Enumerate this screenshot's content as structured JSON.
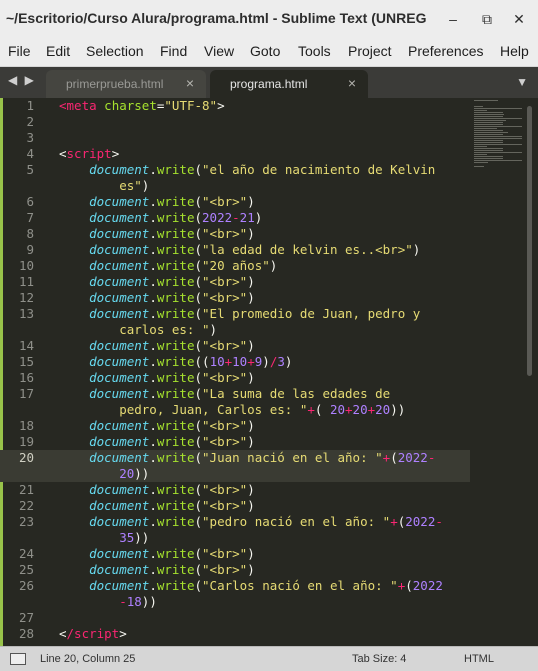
{
  "window": {
    "title": "~/Escritorio/Curso Alura/programa.html - Sublime Text (UNREGI..."
  },
  "controls": {
    "minimize": "–",
    "maximize": "⧉",
    "close": "✕"
  },
  "menu": [
    "File",
    "Edit",
    "Selection",
    "Find",
    "View",
    "Goto",
    "Tools",
    "Project",
    "Preferences",
    "Help"
  ],
  "nav": {
    "arrows": "◀ ▶"
  },
  "tabs": [
    {
      "label": "primerprueba.html",
      "close": "×"
    },
    {
      "label": "programa.html",
      "close": "×"
    }
  ],
  "tab_menu_glyph": "▼",
  "code": [
    {
      "n": "1",
      "t": [
        [
          "tag",
          "<"
        ],
        [
          "tag",
          "meta"
        ],
        [
          "attr",
          " charset"
        ],
        [
          "plain",
          "="
        ],
        [
          "str",
          "\"UTF-8\""
        ],
        [
          "plain",
          ">"
        ]
      ]
    },
    {
      "n": "2",
      "t": []
    },
    {
      "n": "3",
      "t": []
    },
    {
      "n": "4",
      "t": [
        [
          "plain",
          "<"
        ],
        [
          "tag",
          "script"
        ],
        [
          "plain",
          ">"
        ]
      ]
    },
    {
      "n": "5",
      "t": [
        [
          "plain",
          "    "
        ],
        [
          "obj",
          "document"
        ],
        [
          "plain",
          "."
        ],
        [
          "fn",
          "write"
        ],
        [
          "plain",
          "("
        ],
        [
          "str",
          "\"el año de nacimiento de Kelvin"
        ]
      ]
    },
    {
      "n": "",
      "t": [
        [
          "str",
          "        es\""
        ],
        [
          "plain",
          ")"
        ]
      ]
    },
    {
      "n": "6",
      "t": [
        [
          "plain",
          "    "
        ],
        [
          "obj",
          "document"
        ],
        [
          "plain",
          "."
        ],
        [
          "fn",
          "write"
        ],
        [
          "plain",
          "("
        ],
        [
          "str",
          "\"<br>\""
        ],
        [
          "plain",
          ")"
        ]
      ]
    },
    {
      "n": "7",
      "t": [
        [
          "plain",
          "    "
        ],
        [
          "obj",
          "document"
        ],
        [
          "plain",
          "."
        ],
        [
          "fn",
          "write"
        ],
        [
          "plain",
          "("
        ],
        [
          "num",
          "2022"
        ],
        [
          "op",
          "-"
        ],
        [
          "num",
          "21"
        ],
        [
          "plain",
          ")"
        ]
      ]
    },
    {
      "n": "8",
      "t": [
        [
          "plain",
          "    "
        ],
        [
          "obj",
          "document"
        ],
        [
          "plain",
          "."
        ],
        [
          "fn",
          "write"
        ],
        [
          "plain",
          "("
        ],
        [
          "str",
          "\"<br>\""
        ],
        [
          "plain",
          ")"
        ]
      ]
    },
    {
      "n": "9",
      "t": [
        [
          "plain",
          "    "
        ],
        [
          "obj",
          "document"
        ],
        [
          "plain",
          "."
        ],
        [
          "fn",
          "write"
        ],
        [
          "plain",
          "("
        ],
        [
          "str",
          "\"la edad de kelvin es..<br>\""
        ],
        [
          "plain",
          ")"
        ]
      ]
    },
    {
      "n": "10",
      "t": [
        [
          "plain",
          "    "
        ],
        [
          "obj",
          "document"
        ],
        [
          "plain",
          "."
        ],
        [
          "fn",
          "write"
        ],
        [
          "plain",
          "("
        ],
        [
          "str",
          "\"20 años\""
        ],
        [
          "plain",
          ")"
        ]
      ]
    },
    {
      "n": "11",
      "t": [
        [
          "plain",
          "    "
        ],
        [
          "obj",
          "document"
        ],
        [
          "plain",
          "."
        ],
        [
          "fn",
          "write"
        ],
        [
          "plain",
          "("
        ],
        [
          "str",
          "\"<br>\""
        ],
        [
          "plain",
          ")"
        ]
      ]
    },
    {
      "n": "12",
      "t": [
        [
          "plain",
          "    "
        ],
        [
          "obj",
          "document"
        ],
        [
          "plain",
          "."
        ],
        [
          "fn",
          "write"
        ],
        [
          "plain",
          "("
        ],
        [
          "str",
          "\"<br>\""
        ],
        [
          "plain",
          ")"
        ]
      ]
    },
    {
      "n": "13",
      "t": [
        [
          "plain",
          "    "
        ],
        [
          "obj",
          "document"
        ],
        [
          "plain",
          "."
        ],
        [
          "fn",
          "write"
        ],
        [
          "plain",
          "("
        ],
        [
          "str",
          "\"El promedio de Juan, pedro y"
        ]
      ]
    },
    {
      "n": "",
      "t": [
        [
          "str",
          "        carlos es: \""
        ],
        [
          "plain",
          ")"
        ]
      ]
    },
    {
      "n": "14",
      "t": [
        [
          "plain",
          "    "
        ],
        [
          "obj",
          "document"
        ],
        [
          "plain",
          "."
        ],
        [
          "fn",
          "write"
        ],
        [
          "plain",
          "("
        ],
        [
          "str",
          "\"<br>\""
        ],
        [
          "plain",
          ")"
        ]
      ]
    },
    {
      "n": "15",
      "t": [
        [
          "plain",
          "    "
        ],
        [
          "obj",
          "document"
        ],
        [
          "plain",
          "."
        ],
        [
          "fn",
          "write"
        ],
        [
          "plain",
          "(("
        ],
        [
          "num",
          "10"
        ],
        [
          "op",
          "+"
        ],
        [
          "num",
          "10"
        ],
        [
          "op",
          "+"
        ],
        [
          "num",
          "9"
        ],
        [
          "plain",
          ")"
        ],
        [
          "op",
          "/"
        ],
        [
          "num",
          "3"
        ],
        [
          "plain",
          ")"
        ]
      ]
    },
    {
      "n": "16",
      "t": [
        [
          "plain",
          "    "
        ],
        [
          "obj",
          "document"
        ],
        [
          "plain",
          "."
        ],
        [
          "fn",
          "write"
        ],
        [
          "plain",
          "("
        ],
        [
          "str",
          "\"<br>\""
        ],
        [
          "plain",
          ")"
        ]
      ]
    },
    {
      "n": "17",
      "t": [
        [
          "plain",
          "    "
        ],
        [
          "obj",
          "document"
        ],
        [
          "plain",
          "."
        ],
        [
          "fn",
          "write"
        ],
        [
          "plain",
          "("
        ],
        [
          "str",
          "\"La suma de las edades de"
        ]
      ]
    },
    {
      "n": "",
      "t": [
        [
          "str",
          "        pedro, Juan, Carlos es: \""
        ],
        [
          "op",
          "+"
        ],
        [
          "plain",
          "( "
        ],
        [
          "num",
          "20"
        ],
        [
          "op",
          "+"
        ],
        [
          "num",
          "20"
        ],
        [
          "op",
          "+"
        ],
        [
          "num",
          "20"
        ],
        [
          "plain",
          "))"
        ]
      ]
    },
    {
      "n": "18",
      "t": [
        [
          "plain",
          "    "
        ],
        [
          "obj",
          "document"
        ],
        [
          "plain",
          "."
        ],
        [
          "fn",
          "write"
        ],
        [
          "plain",
          "("
        ],
        [
          "str",
          "\"<br>\""
        ],
        [
          "plain",
          ")"
        ]
      ]
    },
    {
      "n": "19",
      "t": [
        [
          "plain",
          "    "
        ],
        [
          "obj",
          "document"
        ],
        [
          "plain",
          "."
        ],
        [
          "fn",
          "write"
        ],
        [
          "plain",
          "("
        ],
        [
          "str",
          "\"<br>\""
        ],
        [
          "plain",
          ")"
        ]
      ]
    },
    {
      "n": "20",
      "current": true,
      "t": [
        [
          "plain",
          "    "
        ],
        [
          "obj",
          "document"
        ],
        [
          "plain",
          "."
        ],
        [
          "fn",
          "write"
        ],
        [
          "plain",
          "("
        ],
        [
          "str",
          "\"Juan nació en el año: \""
        ],
        [
          "op",
          "+"
        ],
        [
          "plain",
          "("
        ],
        [
          "num",
          "2022"
        ],
        [
          "op",
          "-"
        ]
      ]
    },
    {
      "n": "",
      "current": true,
      "t": [
        [
          "num",
          "        20"
        ],
        [
          "plain",
          "))"
        ]
      ]
    },
    {
      "n": "21",
      "t": [
        [
          "plain",
          "    "
        ],
        [
          "obj",
          "document"
        ],
        [
          "plain",
          "."
        ],
        [
          "fn",
          "write"
        ],
        [
          "plain",
          "("
        ],
        [
          "str",
          "\"<br>\""
        ],
        [
          "plain",
          ")"
        ]
      ]
    },
    {
      "n": "22",
      "t": [
        [
          "plain",
          "    "
        ],
        [
          "obj",
          "document"
        ],
        [
          "plain",
          "."
        ],
        [
          "fn",
          "write"
        ],
        [
          "plain",
          "("
        ],
        [
          "str",
          "\"<br>\""
        ],
        [
          "plain",
          ")"
        ]
      ]
    },
    {
      "n": "23",
      "t": [
        [
          "plain",
          "    "
        ],
        [
          "obj",
          "document"
        ],
        [
          "plain",
          "."
        ],
        [
          "fn",
          "write"
        ],
        [
          "plain",
          "("
        ],
        [
          "str",
          "\"pedro nació en el año: \""
        ],
        [
          "op",
          "+"
        ],
        [
          "plain",
          "("
        ],
        [
          "num",
          "2022"
        ],
        [
          "op",
          "-"
        ]
      ]
    },
    {
      "n": "",
      "t": [
        [
          "num",
          "        35"
        ],
        [
          "plain",
          "))"
        ]
      ]
    },
    {
      "n": "24",
      "t": [
        [
          "plain",
          "    "
        ],
        [
          "obj",
          "document"
        ],
        [
          "plain",
          "."
        ],
        [
          "fn",
          "write"
        ],
        [
          "plain",
          "("
        ],
        [
          "str",
          "\"<br>\""
        ],
        [
          "plain",
          ")"
        ]
      ]
    },
    {
      "n": "25",
      "t": [
        [
          "plain",
          "    "
        ],
        [
          "obj",
          "document"
        ],
        [
          "plain",
          "."
        ],
        [
          "fn",
          "write"
        ],
        [
          "plain",
          "("
        ],
        [
          "str",
          "\"<br>\""
        ],
        [
          "plain",
          ")"
        ]
      ]
    },
    {
      "n": "26",
      "t": [
        [
          "plain",
          "    "
        ],
        [
          "obj",
          "document"
        ],
        [
          "plain",
          "."
        ],
        [
          "fn",
          "write"
        ],
        [
          "plain",
          "("
        ],
        [
          "str",
          "\"Carlos nació en el año: \""
        ],
        [
          "op",
          "+"
        ],
        [
          "plain",
          "("
        ],
        [
          "num",
          "2022"
        ]
      ]
    },
    {
      "n": "",
      "t": [
        [
          "op",
          "        -"
        ],
        [
          "num",
          "18"
        ],
        [
          "plain",
          "))"
        ]
      ]
    },
    {
      "n": "27",
      "t": []
    },
    {
      "n": "28",
      "t": [
        [
          "plain",
          "<"
        ],
        [
          "tag",
          "/script"
        ],
        [
          "plain",
          ">"
        ]
      ]
    }
  ],
  "status": {
    "position": "Line 20, Column 25",
    "tab_size": "Tab Size: 4",
    "syntax": "HTML"
  }
}
